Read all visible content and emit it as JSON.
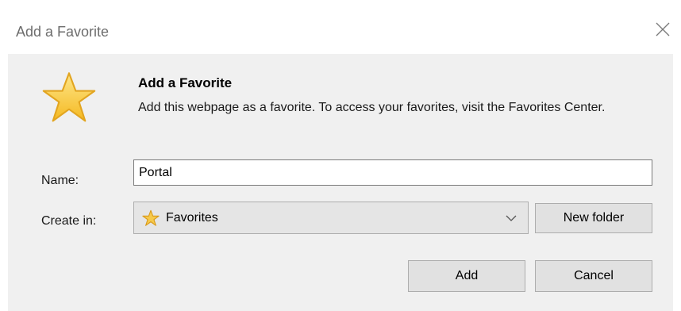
{
  "window": {
    "title": "Add a Favorite"
  },
  "header": {
    "heading": "Add a Favorite",
    "description": "Add this webpage as a favorite. To access your favorites, visit the Favorites Center."
  },
  "form": {
    "name_label": "Name:",
    "name_value": "Portal",
    "create_in_label": "Create in:",
    "create_in_value": "Favorites"
  },
  "buttons": {
    "new_folder": "New folder",
    "add": "Add",
    "cancel": "Cancel"
  },
  "icons": {
    "close": "close-icon",
    "main": "star-icon",
    "folder": "favorites-star-icon",
    "dropdown": "chevron-down-icon"
  },
  "colors": {
    "dialog_background": "#f0f0f0",
    "button_background": "#e1e1e1",
    "star_fill": "#f6c94a",
    "star_stroke": "#e2a520"
  }
}
